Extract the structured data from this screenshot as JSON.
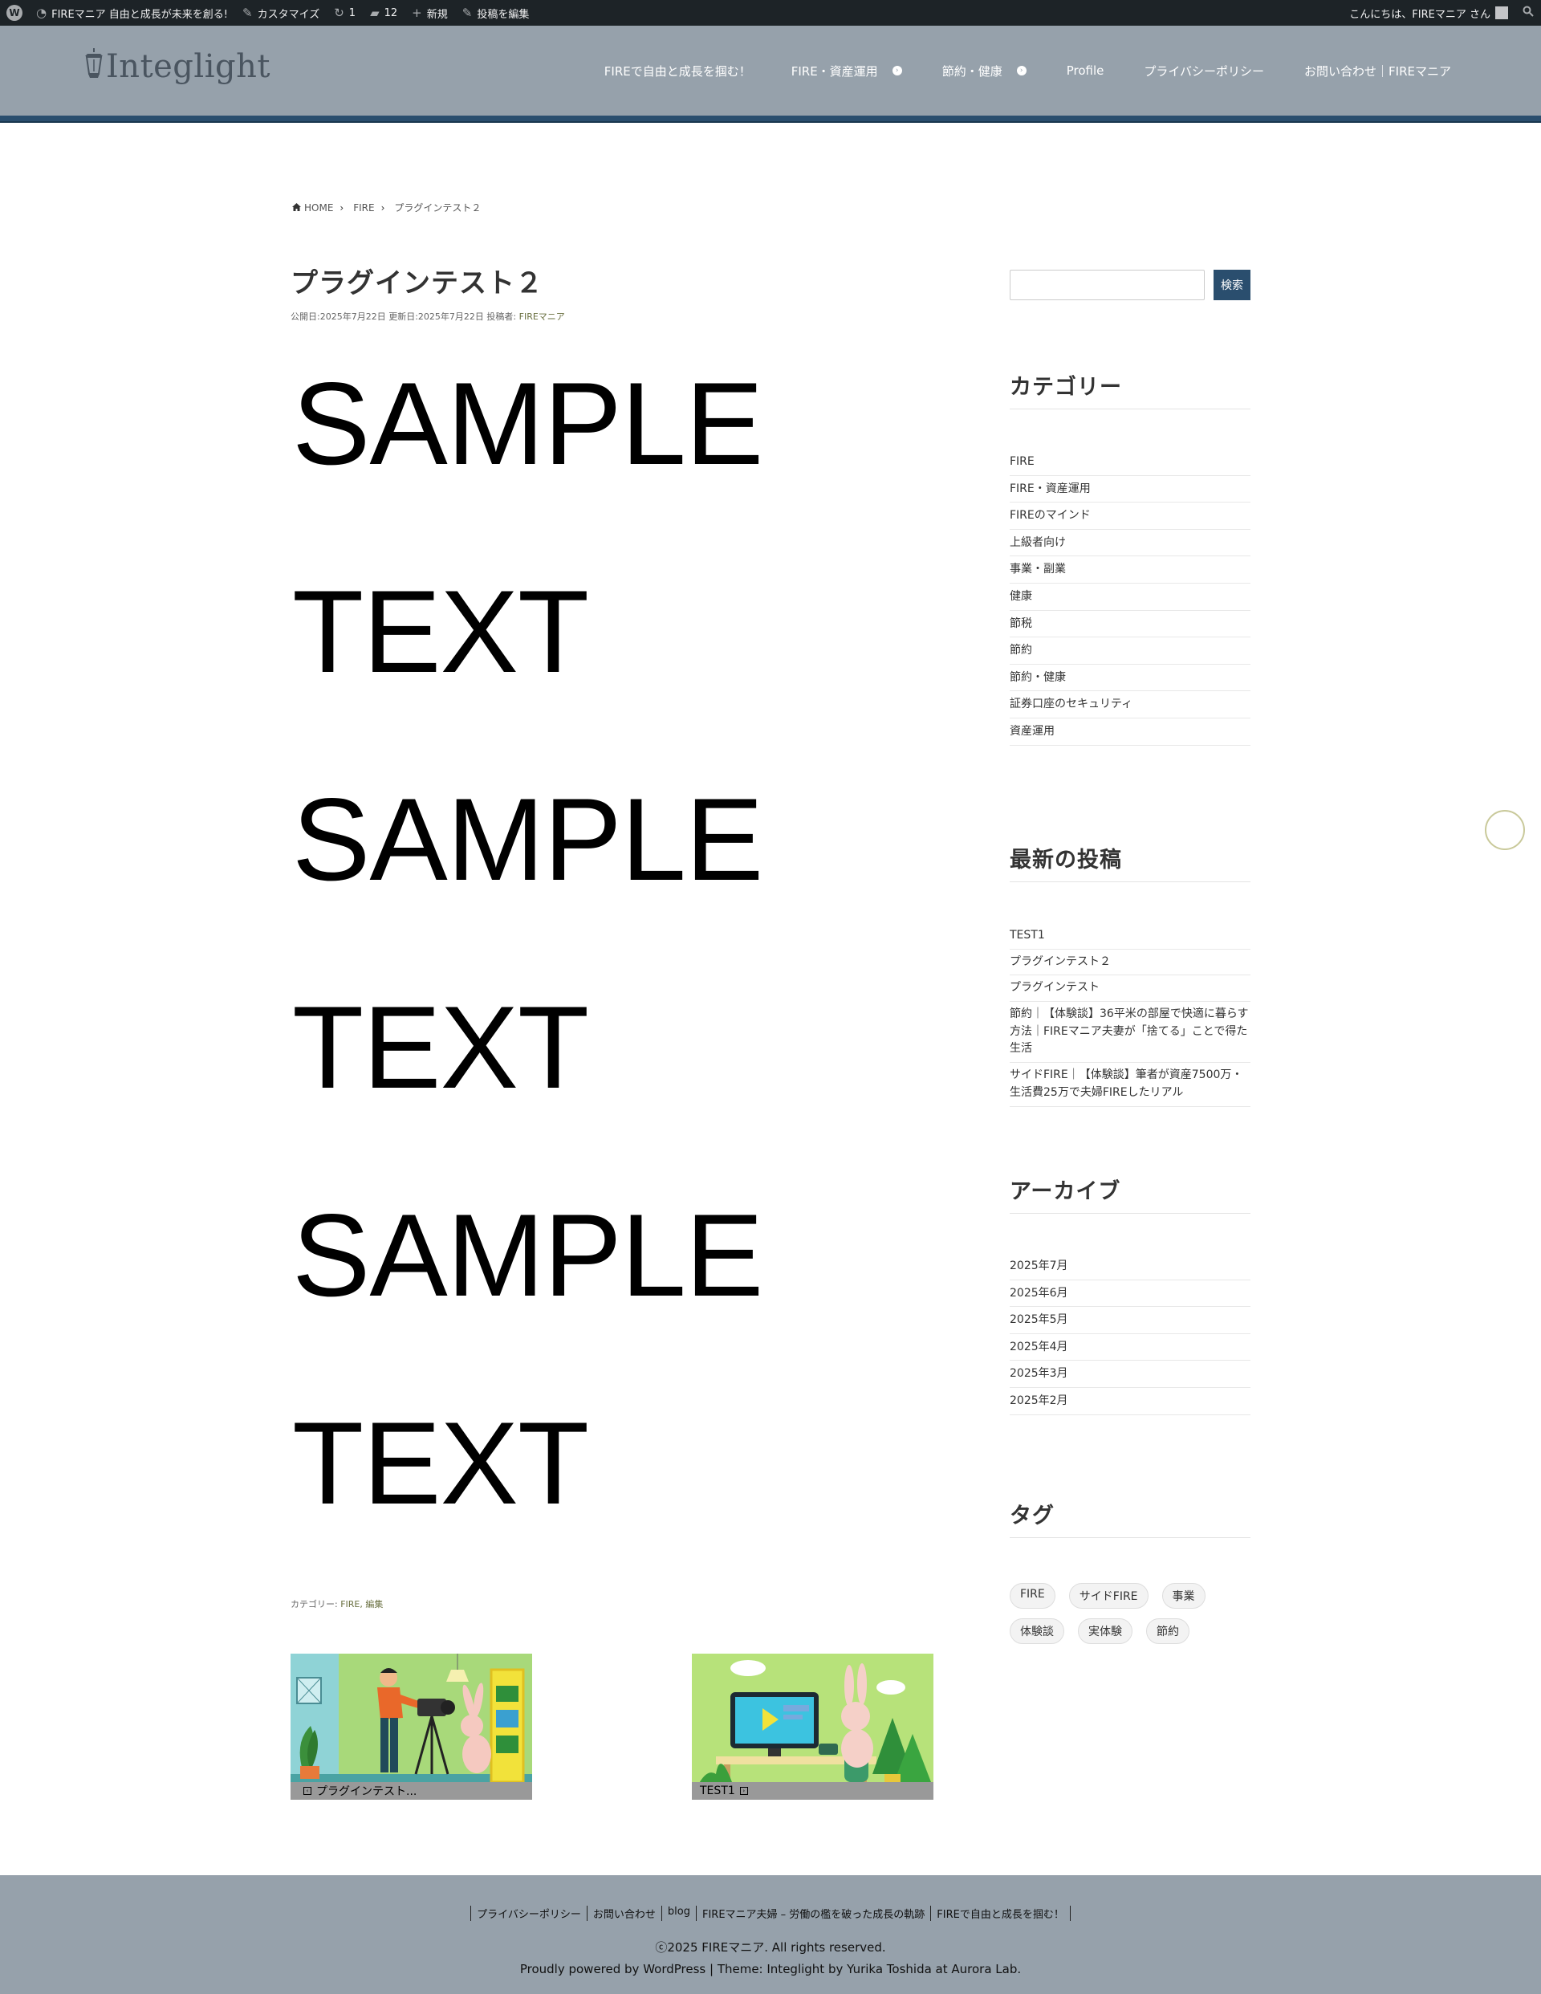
{
  "adminbar": {
    "site_name": "FIREマニア 自由と成長が未来を創る!",
    "customize": "カスタマイズ",
    "updates": "1",
    "comments": "12",
    "new": "新規",
    "edit_post": "投稿を編集",
    "greeting": "こんにちは、FIREマニア さん"
  },
  "header": {
    "logo_text": "Integlight",
    "nav": [
      "FIREで自由と成長を掴む！",
      "FIRE・資産運用",
      "節約・健康",
      "Profile",
      "プライバシーポリシー",
      "お問い合わせ｜FIREマニア"
    ]
  },
  "breadcrumb": {
    "home": "HOME",
    "cat": "FIRE",
    "current": "プラグインテスト２"
  },
  "post": {
    "title": "プラグインテスト２",
    "meta_published": "公開日:2025年7月22日",
    "meta_updated": "更新日:2025年7月22日",
    "meta_author_label": "投稿者:",
    "meta_author": "FIREマニア",
    "body": [
      "SAMPLE",
      "TEXT",
      "SAMPLE",
      "TEXT",
      "SAMPLE",
      "TEXT"
    ],
    "cats_label": "カテゴリー:",
    "cats": "FIRE, 編集"
  },
  "related": [
    {
      "title": "プラグインテスト..."
    },
    {
      "title": "TEST1"
    }
  ],
  "sidebar": {
    "search_placeholder": "",
    "search_button": "検索",
    "categories_title": "カテゴリー",
    "categories": [
      "FIRE",
      "FIRE・資産運用",
      "FIREのマインド",
      "上級者向け",
      "事業・副業",
      "健康",
      "節税",
      "節約",
      "節約・健康",
      "証券口座のセキュリティ",
      "資産運用"
    ],
    "recent_title": "最新の投稿",
    "recent": [
      "TEST1",
      "プラグインテスト２",
      "プラグインテスト",
      "節約｜【体験談】36平米の部屋で快適に暮らす方法｜FIREマニア夫妻が「捨てる」ことで得た生活",
      "サイドFIRE｜【体験談】筆者が資産7500万・生活費25万で夫婦FIREしたリアル"
    ],
    "archive_title": "アーカイブ",
    "archive": [
      "2025年7月",
      "2025年6月",
      "2025年5月",
      "2025年4月",
      "2025年3月",
      "2025年2月"
    ],
    "tags_title": "タグ",
    "tags": [
      "FIRE",
      "サイドFIRE",
      "事業",
      "体験談",
      "実体験",
      "節約"
    ]
  },
  "footer": {
    "links": [
      "プライバシーポリシー",
      "お問い合わせ",
      "blog",
      "FIREマニア夫婦 – 労働の檻を破った成長の軌跡",
      "FIREで自由と成長を掴む！"
    ],
    "copyright": "ⓒ2025 FIREマニア. All rights reserved.",
    "powered": "Proudly powered by WordPress | Theme: Integlight by Yurika Toshida at Aurora Lab."
  },
  "colors": {
    "header": "#96a1ab",
    "accent": "#2a4e6e",
    "adminbar": "#1d2327"
  }
}
